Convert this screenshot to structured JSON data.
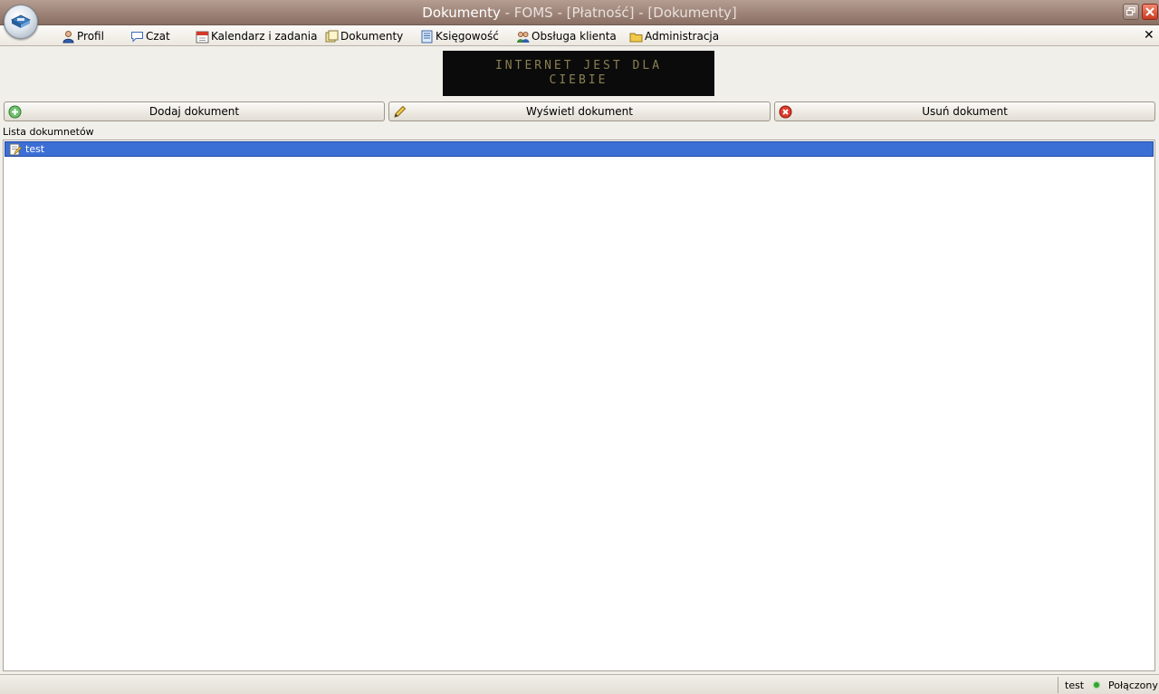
{
  "window": {
    "title_main": "Dokumenty",
    "title_rest": " - FOMS - [Płatność] - [Dokumenty]"
  },
  "menu": {
    "items": [
      {
        "label": "Profil",
        "icon": "user-icon"
      },
      {
        "label": "Czat",
        "icon": "chat-bubble-icon"
      },
      {
        "label": "Kalendarz i zadania",
        "icon": "calendar-icon"
      },
      {
        "label": "Dokumenty",
        "icon": "documents-icon"
      },
      {
        "label": "Księgowość",
        "icon": "ledger-icon"
      },
      {
        "label": "Obsługa klienta",
        "icon": "customers-icon"
      },
      {
        "label": "Administracja",
        "icon": "folder-icon"
      }
    ]
  },
  "banner": {
    "line1": "INTERNET JEST DLA",
    "line2": "CIEBIE"
  },
  "toolbar": {
    "add_label": "Dodaj dokument",
    "view_label": "Wyświetl dokument",
    "delete_label": "Usuń dokument"
  },
  "list": {
    "label": "Lista dokumnetów",
    "items": [
      {
        "name": "test",
        "selected": true
      }
    ]
  },
  "status": {
    "user": "test",
    "connection": "Połączony"
  },
  "colors": {
    "selection": "#3c6fd6",
    "titlebar": "#9c8275",
    "connected": "#2ea82e"
  }
}
